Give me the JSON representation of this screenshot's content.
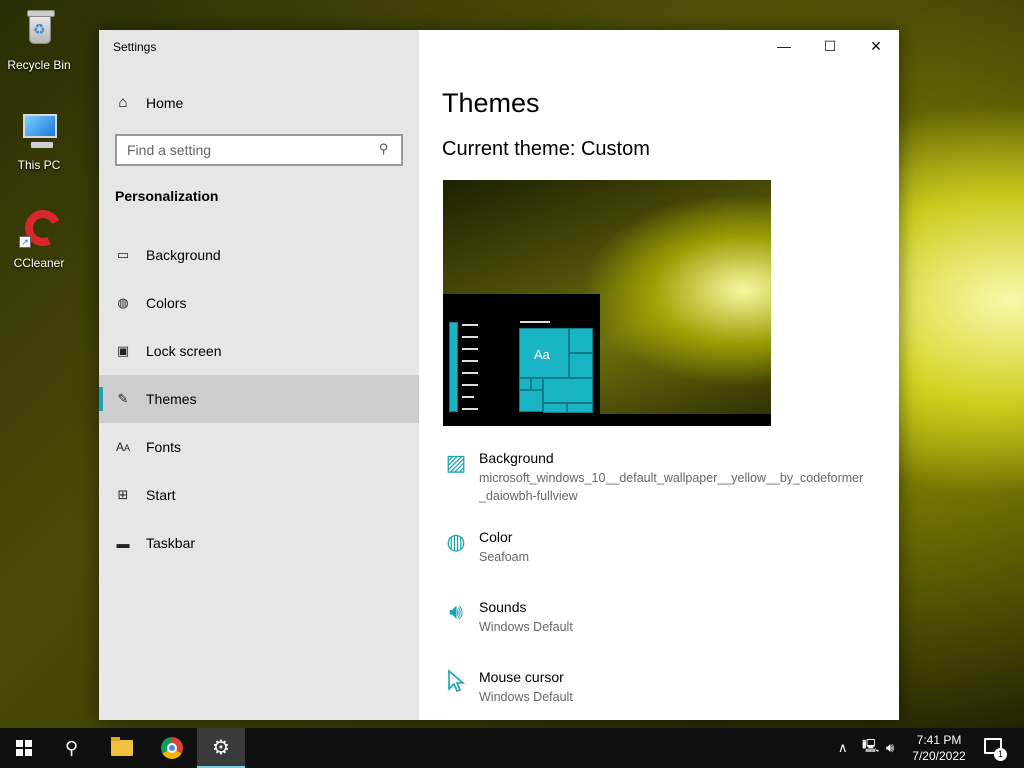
{
  "desktop": {
    "icons": [
      {
        "label": "Recycle Bin"
      },
      {
        "label": "This PC"
      },
      {
        "label": "CCleaner"
      }
    ]
  },
  "window": {
    "title": "Settings",
    "controls": {
      "minimize": "—",
      "maximize": "☐",
      "close": "✕"
    }
  },
  "sidebar": {
    "home_label": "Home",
    "search_placeholder": "Find a setting",
    "section_title": "Personalization",
    "items": [
      {
        "label": "Background",
        "icon": "image-icon",
        "active": false
      },
      {
        "label": "Colors",
        "icon": "palette-icon",
        "active": false
      },
      {
        "label": "Lock screen",
        "icon": "lock-screen-icon",
        "active": false
      },
      {
        "label": "Themes",
        "icon": "brush-icon",
        "active": true
      },
      {
        "label": "Fonts",
        "icon": "font-icon",
        "active": false
      },
      {
        "label": "Start",
        "icon": "start-tiles-icon",
        "active": false
      },
      {
        "label": "Taskbar",
        "icon": "taskbar-icon",
        "active": false
      }
    ]
  },
  "main": {
    "title": "Themes",
    "current_theme": "Current theme: Custom",
    "preview_text": "Aa",
    "options": [
      {
        "title": "Background",
        "value": "microsoft_windows_10__default_wallpaper__yellow__by_codeformer_daiowbh-fullview",
        "icon": "picture-icon"
      },
      {
        "title": "Color",
        "value": "Seafoam",
        "icon": "palette-icon"
      },
      {
        "title": "Sounds",
        "value": "Windows Default",
        "icon": "speaker-icon"
      },
      {
        "title": "Mouse cursor",
        "value": "Windows Default",
        "icon": "cursor-icon"
      }
    ]
  },
  "taskbar": {
    "clock_time": "7:41 PM",
    "clock_date": "7/20/2022",
    "notification_count": "1"
  },
  "colors": {
    "accent": "#1aa3b3",
    "sidebar_bg": "#e6e6e6",
    "taskbar_bg": "#101010"
  }
}
